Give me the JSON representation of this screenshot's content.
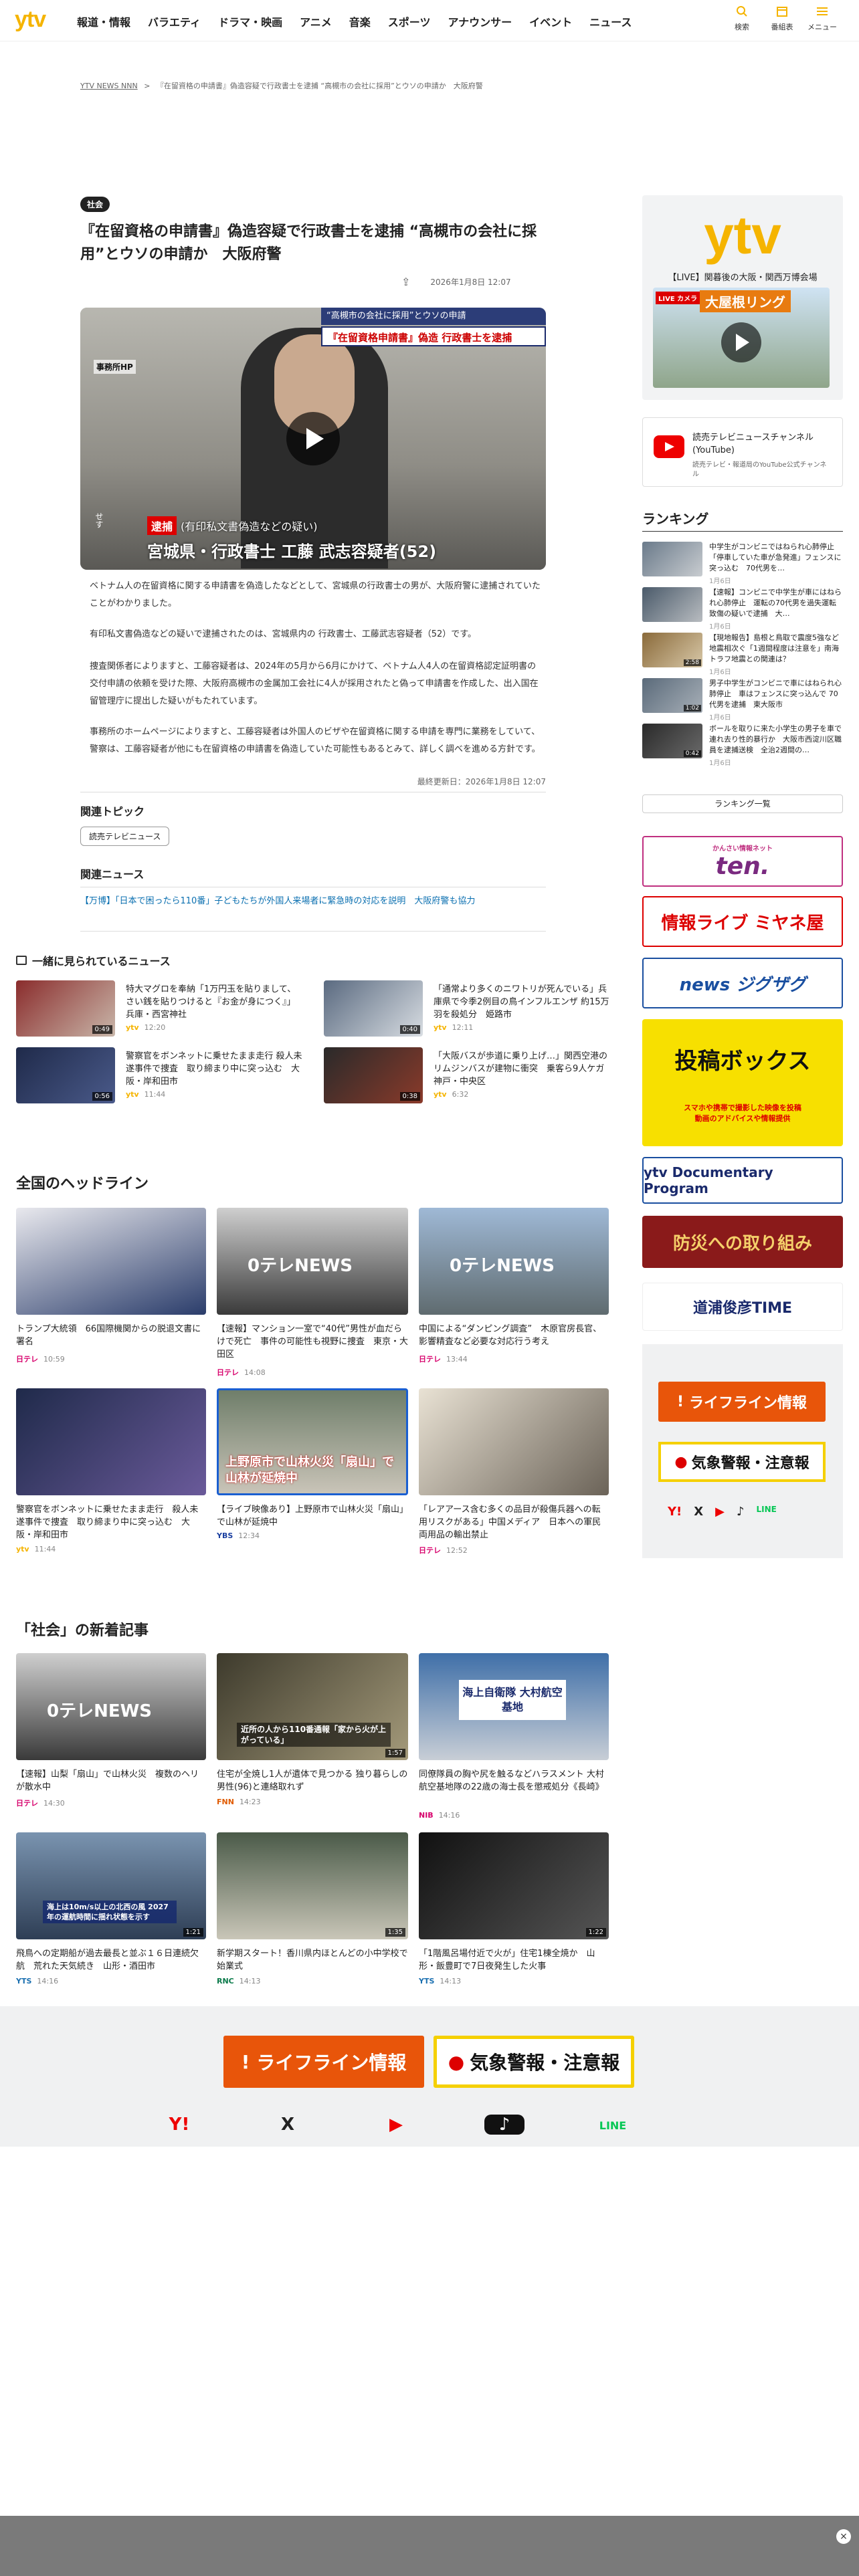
{
  "header": {
    "logo": "ytv",
    "nav": [
      "報道・情報",
      "バラエティ",
      "ドラマ・映画",
      "アニメ",
      "音楽",
      "スポーツ",
      "アナウンサー",
      "イベント",
      "ニュース"
    ],
    "icons": [
      {
        "label": "検索",
        "icon": "search-icon"
      },
      {
        "label": "番組表",
        "icon": "calendar-icon"
      },
      {
        "label": "メニュー",
        "icon": "menu-icon"
      }
    ]
  },
  "breadcrumb": {
    "home": "YTV NEWS NNN",
    "sep": ">",
    "current": "『在留資格の申請書』偽造容疑で行政書士を逮捕 “高槻市の会社に採用”とウソの申請か　大阪府警"
  },
  "article": {
    "category": "社会",
    "title": "『在留資格の申請書』偽造容疑で行政書士を逮捕 “高槻市の会社に採用”とウソの申請か　大阪府警",
    "date": "2026年1月8日 12:07",
    "video": {
      "top_caption": "“高槻市の会社に採用”とウソの申請",
      "headline": "『在留資格申請書』偽造 行政書士を逮捕",
      "side_label": "事務所HP",
      "arrest": "逮捕",
      "charge": "(有印私文書偽造などの疑い)",
      "person": "宮城県・行政書士 工藤 武志容疑者(52)",
      "left_text": "せす"
    },
    "paragraphs": [
      "ベトナム人の在留資格に関する申請書を偽造したなどとして、宮城県の行政書士の男が、大阪府警に逮捕されていたことがわかりました。",
      "有印私文書偽造などの疑いで逮捕されたのは、宮城県内の 行政書士、工藤武志容疑者（52）です。",
      "捜査関係者によりますと、工藤容疑者は、2024年の5月から6月にかけて、ベトナム人4人の在留資格認定証明書の交付申請の依頼を受けた際、大阪府高槻市の金属加工会社に4人が採用されたと偽って申請書を作成した、出入国在留管理庁に提出した疑いがもたれています。",
      "事務所のホームページによりますと、工藤容疑者は外国人のビザや在留資格に関する申請を専門に業務をしていて、警察は、工藤容疑者が他にも在留資格の申請書を偽造していた可能性もあるとみて、詳しく調べを進める方針です。"
    ],
    "updated": "最終更新日：2026年1月8日 12:07"
  },
  "related_topics": {
    "heading": "関連トピック",
    "chips": [
      "読売テレビニュース"
    ]
  },
  "related_news": {
    "heading": "関連ニュース",
    "links": [
      "【万博】「日本で困ったら110番」子どもたちが外国人来場者に緊急時の対応を説明　大阪府警も協力"
    ]
  },
  "also_viewed": {
    "heading": "一緒に見られているニュース",
    "items": [
      {
        "title": "特大マグロを奉納「1万円玉を貼りまして、さい銭を貼りつけると『お金が身につく』」兵庫・西宮神社",
        "src": "ytv",
        "time": "12:20",
        "dur": "0:49"
      },
      {
        "title": "「通常より多くのニワトリが死んでいる」兵庫県で今季2例目の鳥インフルエンザ 約15万羽を殺処分　姫路市",
        "src": "ytv",
        "time": "12:11",
        "dur": "0:40"
      },
      {
        "title": "警察官をボンネットに乗せたまま走行 殺人未遂事件で捜査　取り締まり中に突っ込む　大阪・岸和田市",
        "src": "ytv",
        "time": "11:44",
        "dur": "0:56"
      },
      {
        "title": "「大阪バスが歩道に乗り上げ…」関西空港のリムジンバスが建物に衝突　乗客ら9人ケガ　神戸・中央区",
        "src": "ytv",
        "time": "6:32",
        "dur": "0:38"
      }
    ]
  },
  "national": {
    "heading": "全国のヘッドライン",
    "items": [
      {
        "title": "トランプ大統領　66国際機関からの脱退文書に署名",
        "src": "日テレ",
        "time": "10:59"
      },
      {
        "title": "【速報】マンション一室で“40代”男性が血だらけで死亡　事件の可能性も視野に捜査　東京・大田区",
        "src": "日テレ",
        "time": "14:08"
      },
      {
        "title": "中国による“ダンピング調査”　木原官房長官、影響精査など必要な対応行う考え",
        "src": "日テレ",
        "time": "13:44"
      },
      {
        "title": "警察官をボンネットに乗せたまま走行　殺人未遂事件で捜査　取り締まり中に突っ込む　大阪・岸和田市",
        "src": "ytv",
        "time": "11:44"
      },
      {
        "title": "【ライブ映像あり】上野原市で山林火災「扇山」で山林が延焼中",
        "src": "YBS",
        "time": "12:34"
      },
      {
        "title": "「レアアース含む多くの品目が殺傷兵器への転用リスクがある」中国メディア　日本への軍民両用品の輸出禁止",
        "src": "日テレ",
        "time": "12:52"
      }
    ],
    "thumb_texts": [
      "0テレNEWS",
      "0テレNEWS",
      "上野原市で山林火災「扇山」で山林が延焼中"
    ]
  },
  "social": {
    "heading": "「社会」の新着記事",
    "items": [
      {
        "title": "【速報】山梨「扇山」で山林火災　複数のヘリが散水中",
        "src": "日テレ",
        "time": "14:30"
      },
      {
        "title": "住宅が全焼し1人が遺体で見つかる 独り暮らしの男性(96)と連絡取れず",
        "src": "FNN",
        "time": "14:23"
      },
      {
        "title": "同僚隊員の胸や尻を触るなどハラスメント 大村航空基地隊の22歳の海士長を懲戒処分《長崎》",
        "src": "NIB",
        "time": "14:16"
      },
      {
        "title": "飛鳥への定期船が過去最長と並ぶ１６日連続欠航　荒れた天気続き　山形・酒田市",
        "src": "YTS",
        "time": "14:16"
      },
      {
        "title": "新学期スタート！香川県内ほとんどの小中学校で始業式",
        "src": "RNC",
        "time": "14:13"
      },
      {
        "title": "「1階風呂場付近で火が」住宅1棟全焼か　山形・飯豊町で7日夜発生した火事",
        "src": "YTS",
        "time": "14:13"
      }
    ],
    "durs": [
      "",
      "1:57",
      "",
      "1:21",
      "1:35",
      "1:22"
    ],
    "thumb_texts": [
      "0テレNEWS",
      "近所の人から110番通報「家から火が上がっている」",
      "海上自衛隊 大村航空基地",
      "海上は10m/s以上の北西の風 2027年の運航時間に揺れ状態を示す",
      "",
      ""
    ]
  },
  "sidebar": {
    "live_logo": "ytv",
    "live_title": "【LIVE】関暮後の大阪・関西万博会場",
    "live_banner": "大屋根リング",
    "live_label": "LIVE カメラ",
    "youtube_title": "読売テレビニュースチャンネル(YouTube)",
    "youtube_sub": "読売テレビ・報道局のYouTube公式チャンネル",
    "ranking_heading": "ランキング",
    "ranking": [
      {
        "title": "中学生がコンビニではねられ心肺停止「停車していた車が急発進」フェンスに突っ込む　70代男を…",
        "date": "1月6日"
      },
      {
        "title": "【速報】コンビニで中学生が車にはねられ心肺停止　運転の70代男を過失運転致傷の疑いで逮捕　大…",
        "date": "1月6日"
      },
      {
        "title": "【現地報告】島根と鳥取で震度5強など地震相次ぐ「1週間程度は注意を」南海トラフ地震との関連は？",
        "date": "1月6日",
        "dur": "2:58"
      },
      {
        "title": "男子中学生がコンビニで車にはねられ心肺停止　車はフェンスに突っ込んで 70代男を逮捕　東大阪市",
        "date": "1月6日",
        "dur": "1:02"
      },
      {
        "title": "ボールを取りに来た小学生の男子を車で連れ去り性的暴行か　大阪市西淀川区職員を逮捕送検　全治2週間の…",
        "date": "1月6日",
        "dur": "0:42"
      }
    ],
    "ranking_btn": "ランキング一覧",
    "banners": [
      {
        "name": "ten",
        "label": "ten.",
        "sub": "かんさい情報ネット"
      },
      {
        "name": "miyaneya",
        "label": "情報ライブ ミヤネ屋"
      },
      {
        "name": "zigzag",
        "label": "news ジグザグ"
      },
      {
        "name": "toko",
        "label": "投稿ボックス",
        "sub": "スマホや携帯で撮影した映像を投稿",
        "sub2": "動画のアドバイスや情報提供"
      },
      {
        "name": "documentary",
        "label": "ytv Documentary Program"
      },
      {
        "name": "bosai",
        "label": "防災への取り組み"
      },
      {
        "name": "michinoku",
        "label": "道浦俊彦TIME"
      }
    ],
    "lifeline": "ライフライン情報",
    "weather": "気象警報・注意報"
  },
  "footer": {
    "lifeline": "ライフライン情報",
    "weather": "気象警報・注意報",
    "social": [
      {
        "name": "yahoo",
        "label": "Y!"
      },
      {
        "name": "x",
        "label": "X"
      },
      {
        "name": "youtube",
        "label": "▶"
      },
      {
        "name": "tiktok",
        "label": "♪"
      },
      {
        "name": "line",
        "label": "LINE"
      }
    ]
  },
  "close_label": "×"
}
